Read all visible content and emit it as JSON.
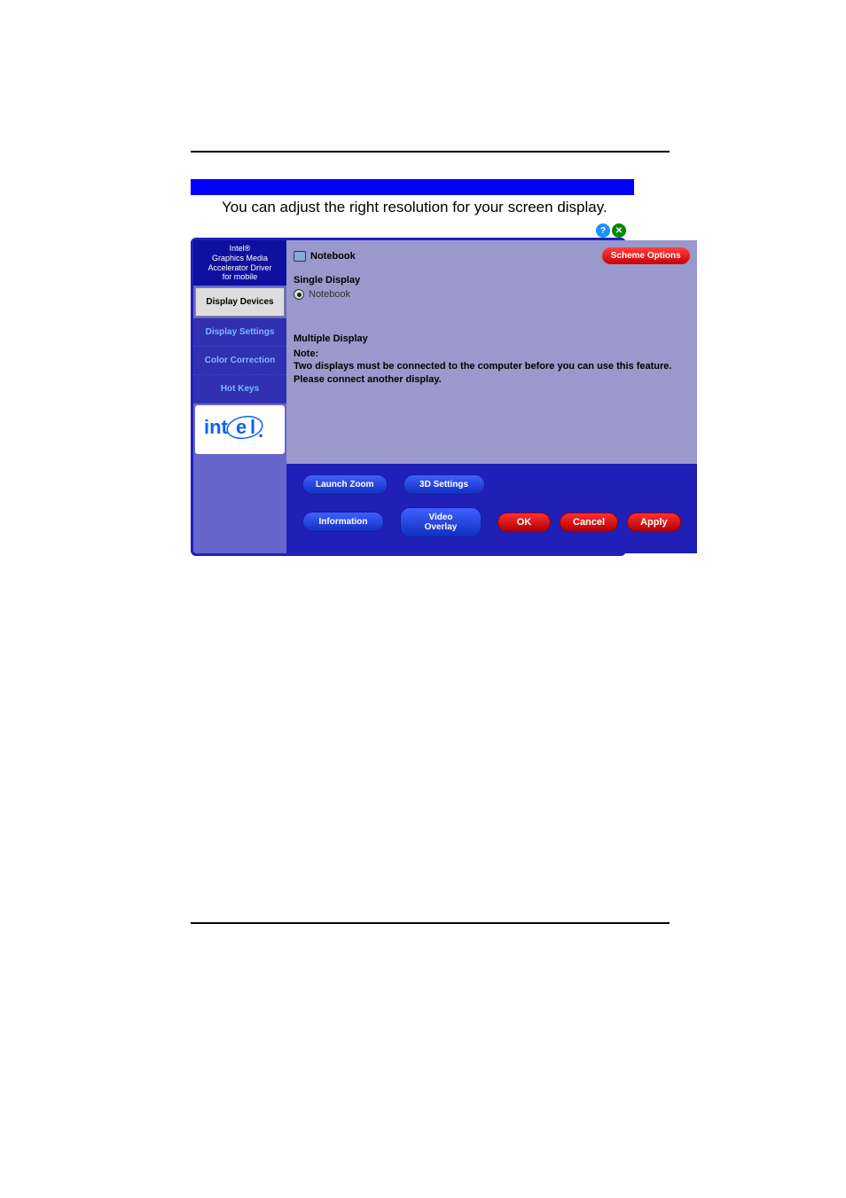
{
  "instruction": "You can adjust the right resolution for your screen display.",
  "sidebar": {
    "header_line1": "Intel®",
    "header_line2": "Graphics Media",
    "header_line3": "Accelerator Driver",
    "header_line4": "for mobile",
    "items": [
      {
        "label": "Display Devices"
      },
      {
        "label": "Display Settings"
      },
      {
        "label": "Color Correction"
      },
      {
        "label": "Hot Keys"
      }
    ],
    "logo": "intel."
  },
  "main": {
    "device_name": "Notebook",
    "scheme_options_label": "Scheme Options",
    "single_display": {
      "heading": "Single Display",
      "option": "Notebook"
    },
    "multiple_display": {
      "heading": "Multiple Display",
      "note_label": "Note:",
      "note_text": "Two displays must be connected to the computer before you can use this feature.  Please connect another display."
    }
  },
  "bottom_buttons": {
    "launch_zoom": "Launch Zoom",
    "three_d_settings": "3D Settings",
    "information": "Information",
    "video_overlay": "Video Overlay",
    "ok": "OK",
    "cancel": "Cancel",
    "apply": "Apply"
  }
}
